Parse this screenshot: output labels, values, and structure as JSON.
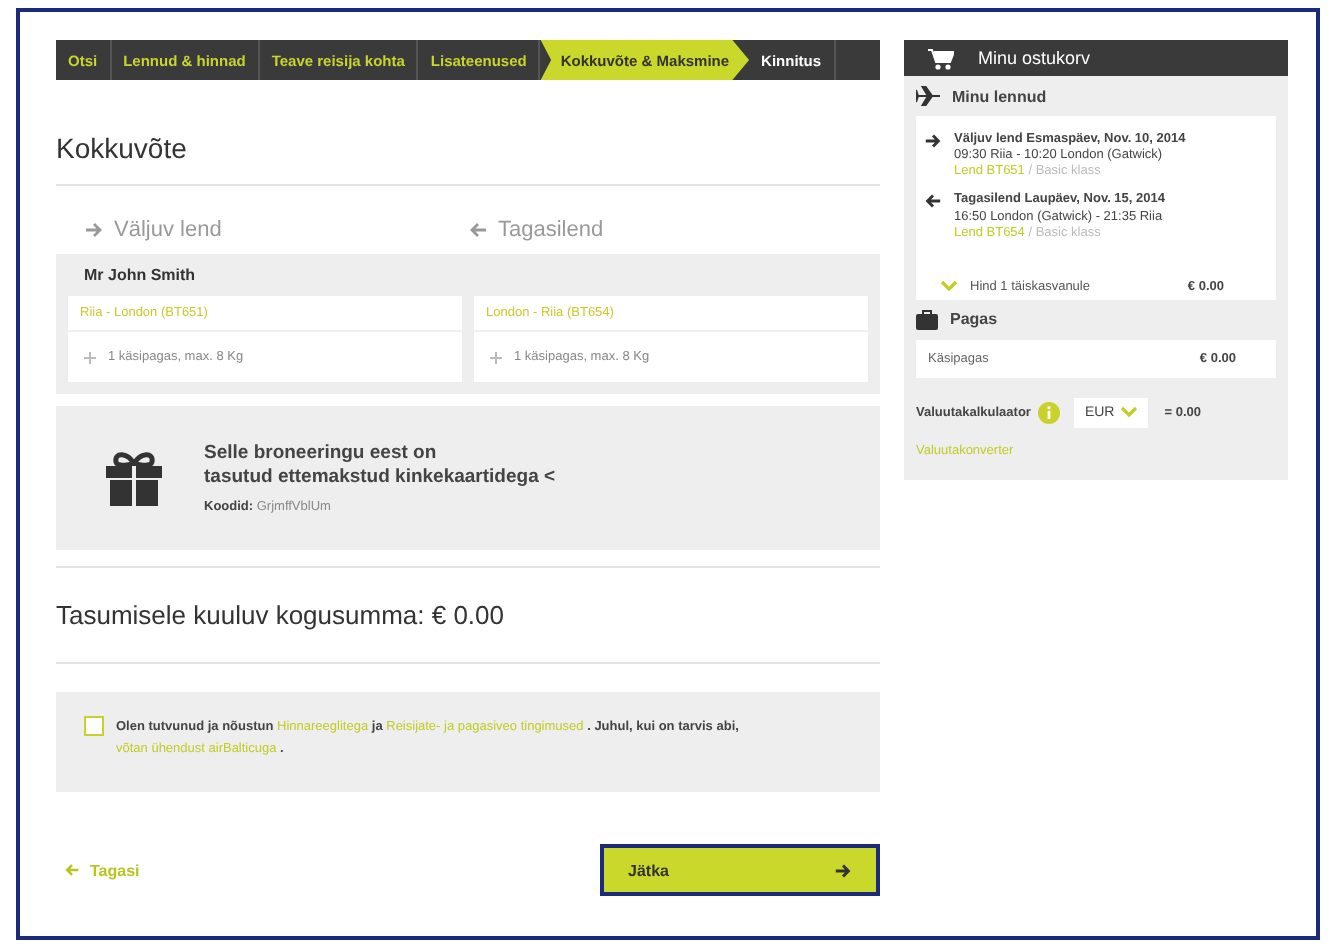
{
  "breadcrumb": [
    {
      "label": "Otsi",
      "completed": true,
      "selected": false
    },
    {
      "label": "Lennud & hinnad",
      "completed": true,
      "selected": false
    },
    {
      "label": "Teave reisija kohta",
      "completed": true,
      "selected": false
    },
    {
      "label": "Lisateenused",
      "completed": true,
      "selected": false
    },
    {
      "label": "Kokkuvõte & Maksmine",
      "completed": false,
      "selected": true
    },
    {
      "label": "Kinnitus",
      "completed": false,
      "selected": false
    }
  ],
  "heading": "Kokkuvõte",
  "directions": [
    {
      "kind": "outbound",
      "label": "Väljuv lend"
    },
    {
      "kind": "return",
      "label": "Tagasilend"
    }
  ],
  "passenger": {
    "name": "Mr John Smith",
    "segments": [
      {
        "route": "Riia - London (BT651)",
        "baggage": "1 käsipagas, max. 8 Kg"
      },
      {
        "route": "London - Riia (BT654)",
        "baggage": "1 käsipagas, max. 8 Kg"
      }
    ]
  },
  "gift": {
    "lines": [
      "Selle broneeringu eest on",
      "tasutud ettemakstud kinkekaartidega <"
    ],
    "codes_label": "Koodid:",
    "codes": "GrjmffVblUm"
  },
  "total": "Tasumisele kuuluv kogusumma: € 0.00",
  "terms": {
    "checked": false,
    "parts": [
      {
        "text": "Olen tutvunud ja nõustun",
        "kind": "text"
      },
      {
        "text": "Hinnareeglitega",
        "kind": "link"
      },
      {
        "text": "ja",
        "kind": "text"
      },
      {
        "text": "Reisijate- ja pagasiveo tingimused",
        "kind": "link"
      },
      {
        "text": ". Juhul, kui on tarvis abi,",
        "kind": "text"
      },
      {
        "text": "võtan ühendust airBalticuga",
        "kind": "link"
      },
      {
        "text": ".",
        "kind": "text"
      }
    ]
  },
  "back": "Tagasi",
  "continue": "Jätka",
  "cart": {
    "title": "Minu ostukorv",
    "flights_title": "Minu lennud",
    "flights": [
      {
        "kind": "outbound",
        "title": "Väljuv lend Esmaspäev, Nov. 10, 2014",
        "times": "09:30 Riia - 10:20 London (Gatwick)",
        "flight": "Lend BT651",
        "class": "/ Basic klass"
      },
      {
        "kind": "return",
        "title": "Tagasilend Laupäev, Nov. 15, 2014",
        "times": "16:50 London (Gatwick) - 21:35 Riia",
        "flight": "Lend BT654",
        "class": "/ Basic klass"
      }
    ],
    "fare": {
      "label": "Hind 1 täiskasvanule",
      "price": "€ 0.00",
      "expanded": false
    },
    "baggage_title": "Pagas",
    "baggage": [
      {
        "label": "Käsipagas",
        "price": "€ 0.00"
      }
    ],
    "currency": {
      "label": "Valuutakalkulaator",
      "value": "EUR",
      "result": "= 0.00",
      "link": "Valuutakonverter"
    }
  }
}
